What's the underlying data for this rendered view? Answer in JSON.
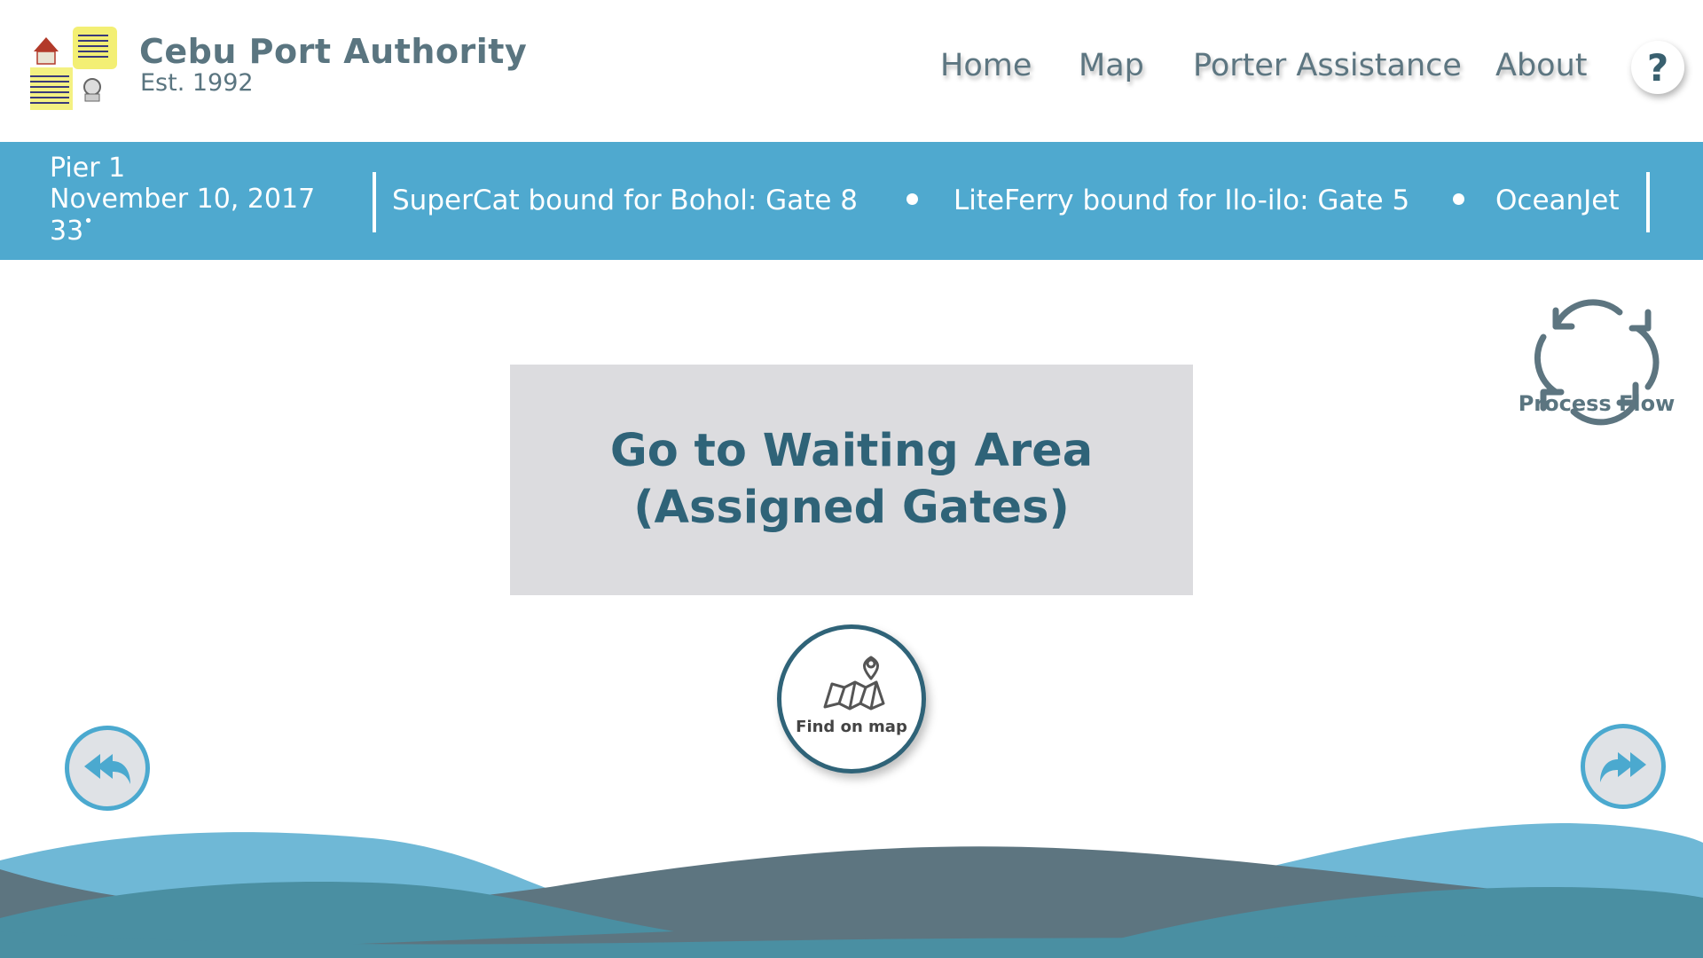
{
  "brand": {
    "title": "Cebu Port Authority",
    "subtitle": "Est. 1992"
  },
  "nav": {
    "home": "Home",
    "map": "Map",
    "porter": "Porter Assistance",
    "about": "About",
    "help": "?"
  },
  "infobar": {
    "pier": "Pier 1",
    "date": "November 10, 2017",
    "temperature": "33",
    "degree_symbol": "•",
    "ticker": [
      "SuperCat bound for Bohol: Gate 8",
      "LiteFerry bound for Ilo-ilo: Gate 5",
      "OceanJet"
    ]
  },
  "process_flow": {
    "label": "Process Flow",
    "icon": "cycle-arrows-icon"
  },
  "main": {
    "line1": "Go to Waiting Area",
    "line2": "(Assigned Gates)"
  },
  "find_on_map": {
    "label": "Find on map",
    "icon": "map-pin-icon"
  },
  "colors": {
    "accent": "#4fa9cf",
    "text_dark": "#2f6378",
    "panel": "#dcdcdf",
    "wave_light": "#6fb8d6",
    "wave_gray": "#5d7580",
    "wave_teal": "#4a8fa2"
  }
}
